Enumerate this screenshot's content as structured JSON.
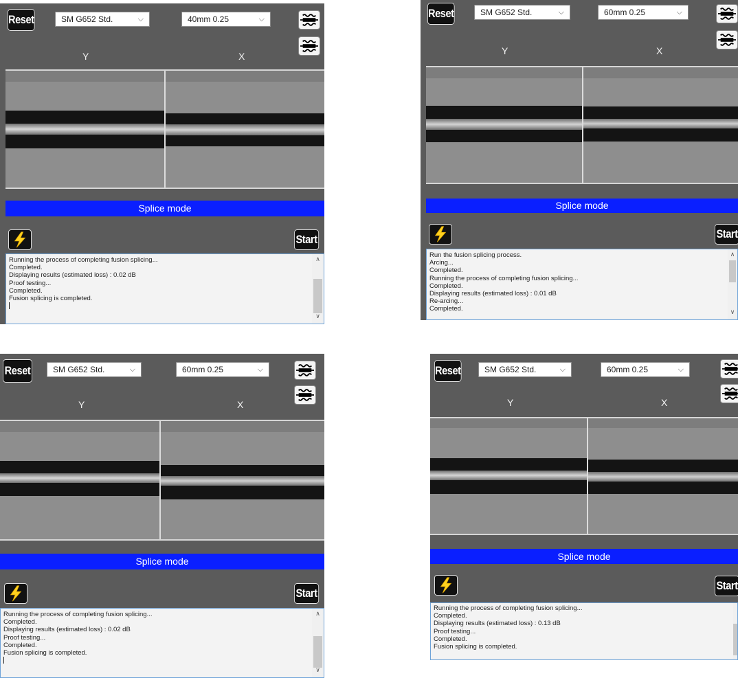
{
  "common": {
    "reset_label": "Reset",
    "start_label": "Start",
    "y_label": "Y",
    "x_label": "X",
    "mode_label": "Splice mode",
    "fiber_type": "SM G652 Std.",
    "icons": {
      "dropdown": "chevron-down-icon",
      "motor": "motor-clamp-icon",
      "arc": "lightning-arc-icon",
      "scroll_up": "scroll-up-icon",
      "scroll_down": "scroll-down-icon"
    },
    "colors": {
      "panel_bg": "#5b5b5b",
      "mode_bar": "#0a1fff",
      "log_bg": "#f3f3f3",
      "arc_bolt": "#ffd21f"
    }
  },
  "panels": [
    {
      "fiber_type": "SM G652 Std.",
      "cleave_setting": "40mm 0.25",
      "log_lines": [
        "Running the process of completing fusion splicing...",
        "Completed.",
        "Displaying results (estimated loss) : 0.02 dB",
        "Proof testing...",
        "Completed.",
        "Fusion splicing is completed."
      ],
      "estimated_loss_db": 0.02
    },
    {
      "fiber_type": "SM G652 Std.",
      "cleave_setting": "60mm 0.25",
      "log_lines": [
        "Run the fusion splicing process.",
        "Arcing...",
        "Completed.",
        "Running the process of completing fusion splicing...",
        "Completed.",
        "Displaying results (estimated loss) : 0.01 dB",
        "Re-arcing...",
        "Completed."
      ],
      "estimated_loss_db": 0.01
    },
    {
      "fiber_type": "SM G652 Std.",
      "cleave_setting": "60mm 0.25",
      "log_lines": [
        "Running the process of completing fusion splicing...",
        "Completed.",
        "Displaying results (estimated loss) : 0.02 dB",
        "Proof testing...",
        "Completed.",
        "Fusion splicing is completed."
      ],
      "estimated_loss_db": 0.02
    },
    {
      "fiber_type": "SM G652 Std.",
      "cleave_setting": "60mm 0.25",
      "log_lines": [
        "Running the process of completing fusion splicing...",
        "Completed.",
        "Displaying results (estimated loss) : 0.13 dB",
        "Proof testing...",
        "Completed.",
        "Fusion splicing is completed."
      ],
      "estimated_loss_db": 0.13
    }
  ]
}
